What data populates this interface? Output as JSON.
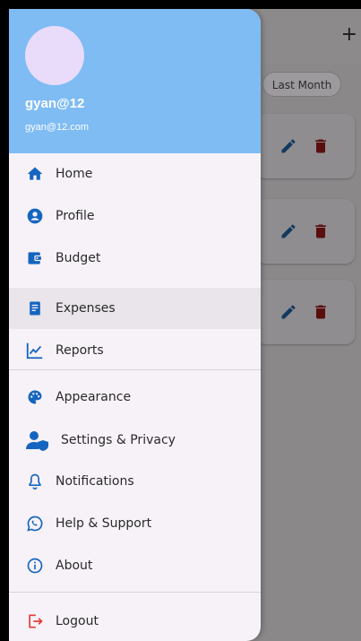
{
  "background_app": {
    "add_symbol": "+",
    "filter_chip": "Last Month"
  },
  "drawer": {
    "user": {
      "name": "gyan@12",
      "email": "gyan@12.com"
    },
    "menu": [
      {
        "label": "Home",
        "icon": "home-icon"
      },
      {
        "label": "Profile",
        "icon": "profile-icon"
      },
      {
        "label": "Budget",
        "icon": "wallet-icon"
      },
      {
        "label": "Expenses",
        "icon": "receipt-icon",
        "selected": true
      },
      {
        "label": "Reports",
        "icon": "chart-icon"
      }
    ],
    "menu2": [
      {
        "label": "Appearance",
        "icon": "palette-icon"
      },
      {
        "label": "Settings & Privacy",
        "icon": "admin-icon"
      },
      {
        "label": "Notifications",
        "icon": "bell-icon"
      },
      {
        "label": "Help & Support",
        "icon": "whatsapp-icon"
      },
      {
        "label": "About",
        "icon": "info-icon"
      }
    ],
    "logout": {
      "label": "Logout",
      "icon": "logout-icon"
    }
  },
  "colors": {
    "header": "#7fbcf4",
    "accent": "#1565c0",
    "danger": "#b71c1c",
    "logout": "#e53935"
  }
}
